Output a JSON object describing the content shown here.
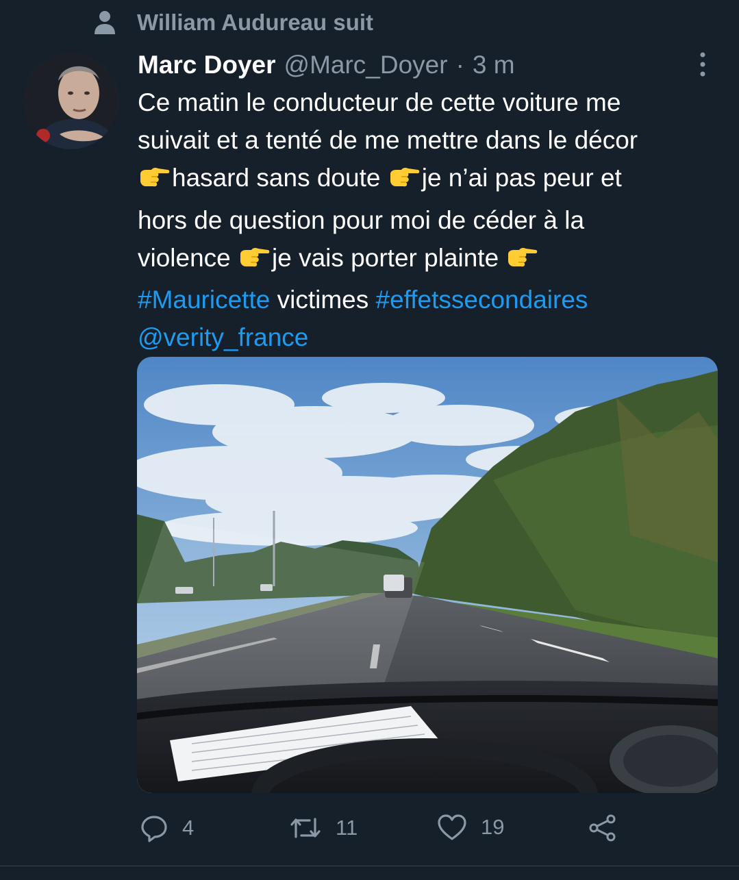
{
  "social_context": {
    "text": "William Audureau suit",
    "icon": "person-icon"
  },
  "tweet": {
    "author_name": "Marc Doyer",
    "author_handle": "@Marc_Doyer",
    "separator": "·",
    "timestamp": "3 m",
    "text_lines": [
      "Ce matin le conducteur de cette voiture me",
      "suivait et a tenté de me mettre dans le décor",
      "hasard sans doute ",
      "je n’ai pas peur et",
      "hors de question pour moi de céder à la",
      "violence ",
      "je vais porter plainte "
    ],
    "hashtag_1": "#Mauricette",
    "text_victimes": " victimes ",
    "hashtag_2": "#effetssecondaires",
    "mention": "@verity_france",
    "emoji": "backhand-index-pointing-right",
    "media_alt_icon": "road-photo"
  },
  "actions": {
    "reply_count": "4",
    "retweet_count": "11",
    "like_count": "19"
  },
  "colors": {
    "background": "#15202b",
    "secondary_text": "#8b98a5",
    "link": "#1d9bf0",
    "text": "#ffffff"
  }
}
